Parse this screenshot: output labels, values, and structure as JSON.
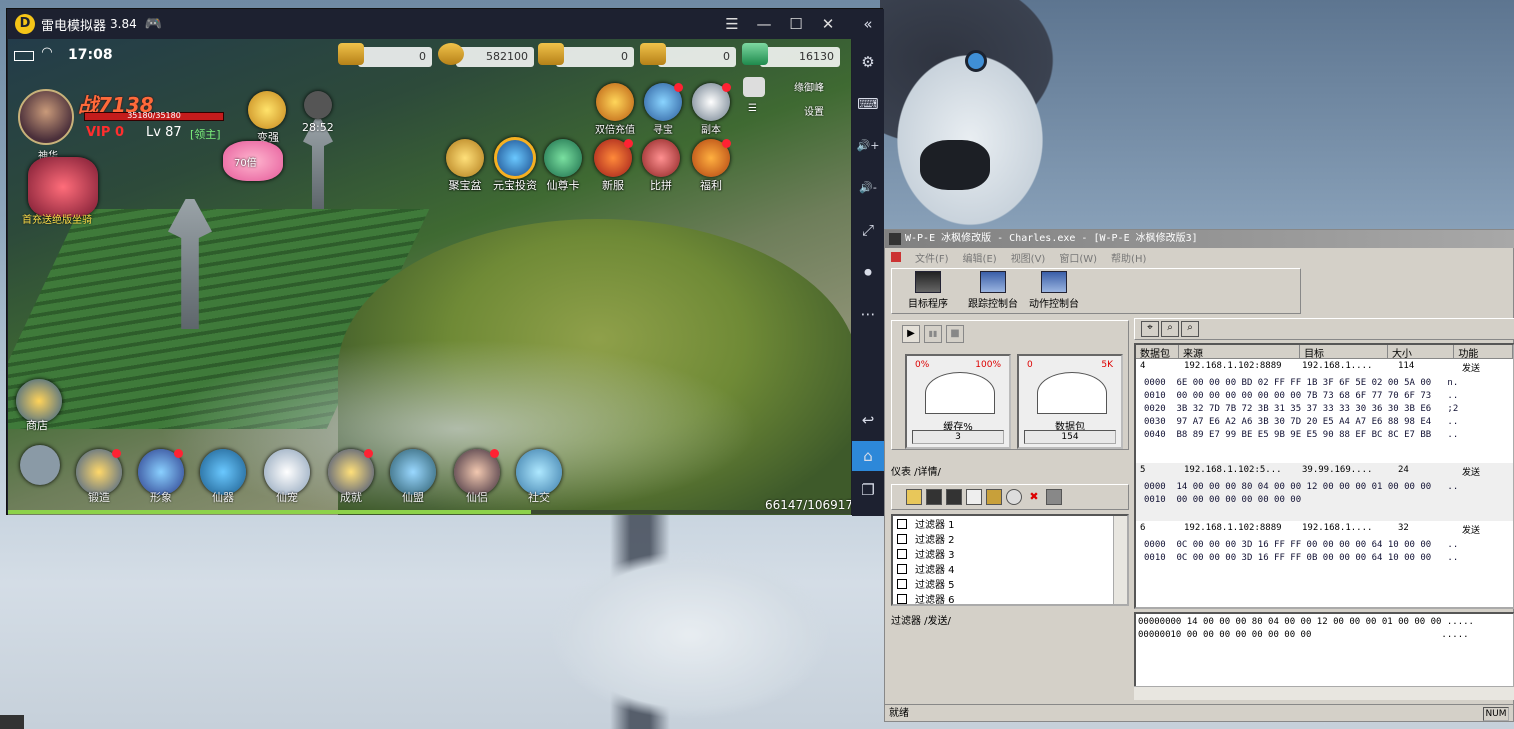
{
  "emulator": {
    "logo": "D",
    "title": "雷电模拟器",
    "version": "3.84",
    "gamepad_icon": "🎮",
    "window_buttons": [
      "☰",
      "—",
      "☐",
      "✕"
    ],
    "side_buttons": [
      "«",
      "⚙",
      "⌨",
      "🔊+",
      "🔊-",
      "⤢",
      "⏺",
      "⋯",
      "↩",
      "⌂",
      "❐"
    ]
  },
  "game": {
    "status": {
      "time": "17:08"
    },
    "resources": [
      "0",
      "582100",
      "0",
      "0",
      "16130"
    ],
    "top_right": {
      "label1": "缘御峰",
      "label2": "设置"
    },
    "player": {
      "power": "战7138",
      "hp": "35180/35180",
      "vip": "VIP 0",
      "level": "Lv 87",
      "badge": "[领主]",
      "name": "神华"
    },
    "labels": {
      "bianqiang": "变强",
      "vip_time": "28:52",
      "first_charge": "首充送绝版坐骑",
      "shop": "商店",
      "hongbao": "70倍"
    },
    "activities": [
      "双倍充值",
      "寻宝",
      "副本",
      "聚宝盆",
      "元宝投资",
      "仙尊卡",
      "新服",
      "比拼",
      "福利"
    ],
    "bottom_buttons": [
      "锻造",
      "形象",
      "仙器",
      "仙宠",
      "成就",
      "仙盟",
      "仙侣",
      "社交"
    ],
    "exp": "66147/106917"
  },
  "wpe": {
    "title": "W-P-E 冰枫修改版 - Charles.exe - [W-P-E 冰枫修改版3]",
    "menu": [
      "文件(F)",
      "编辑(E)",
      "视图(V)",
      "窗口(W)",
      "帮助(H)"
    ],
    "toolbar": [
      "目标程序",
      "跟踪控制台",
      "动作控制台"
    ],
    "playback": [
      "▶",
      "▮▮",
      "■"
    ],
    "meters": [
      {
        "lo": "0%",
        "hi": "100%",
        "name": "缓存%",
        "value": "3"
      },
      {
        "lo": "0",
        "hi": "5K",
        "name": "数据包",
        "value": "154"
      }
    ],
    "tabs_top": "仪表 /详情/",
    "tabs_bottom": "过滤器 /发送/",
    "filters": [
      "过滤器 1",
      "过滤器 2",
      "过滤器 3",
      "过滤器 4",
      "过滤器 5",
      "过滤器 6"
    ],
    "columns": [
      "数据包",
      "来源",
      "目标",
      "大小",
      "功能"
    ],
    "packets": [
      {
        "id": "4",
        "src": "192.168.1.102:8889",
        "dst": "192.168.1....",
        "size": "114",
        "func": "发送",
        "hex": [
          "0000  6E 00 00 00 BD 02 FF FF 1B 3F 6F 5E 02 00 5A 00   n.",
          "0010  00 00 00 00 00 00 00 00 7B 73 68 6F 77 70 6F 73   ..",
          "0020  3B 32 7D 7B 72 3B 31 35 37 33 33 30 36 30 3B E6   ;2",
          "0030  97 A7 E6 A2 A6 3B 30 7D 20 E5 A4 A7 E6 88 98 E4   ..",
          "0040  B8 89 E7 99 BE E5 9B 9E E5 90 88 EF BC 8C E7 BB   .."
        ]
      },
      {
        "id": "5",
        "src": "192.168.1.102:5...",
        "dst": "39.99.169....",
        "size": "24",
        "func": "发送",
        "hex": [
          "0000  14 00 00 00 80 04 00 00 12 00 00 00 01 00 00 00   ..",
          "0010  00 00 00 00 00 00 00 00"
        ]
      },
      {
        "id": "6",
        "src": "192.168.1.102:8889",
        "dst": "192.168.1....",
        "size": "32",
        "func": "发送",
        "hex": [
          "0000  0C 00 00 00 3D 16 FF FF 00 00 00 00 64 10 00 00   ..",
          "0010  0C 00 00 00 3D 16 FF FF 0B 00 00 00 64 10 00 00   .."
        ]
      }
    ],
    "hexdump": [
      "00000000 14 00 00 00 80 04 00 00 12 00 00 00 01 00 00 00 .....",
      "00000010 00 00 00 00 00 00 00 00                        ....."
    ],
    "status": "就绪",
    "status_num": "NUM"
  }
}
